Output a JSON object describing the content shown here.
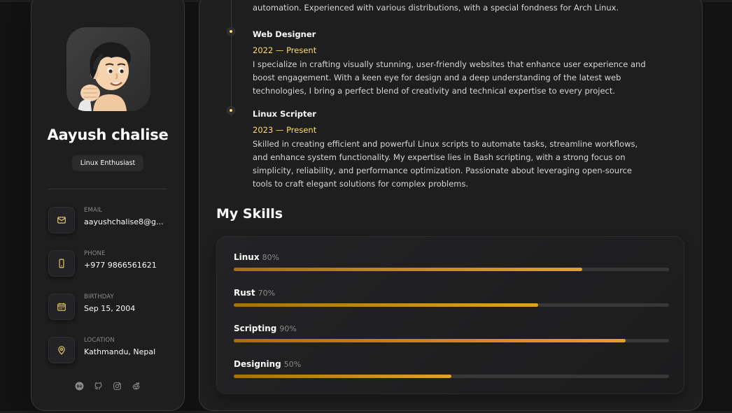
{
  "profile": {
    "name": "Aayush chalise",
    "title": "Linux Enthusiast"
  },
  "contacts": [
    {
      "label": "EMAIL",
      "value": "aayushchalise8@g...",
      "icon": "mail-icon"
    },
    {
      "label": "PHONE",
      "value": "+977 9866561621",
      "icon": "phone-icon"
    },
    {
      "label": "BIRTHDAY",
      "value": "Sep 15, 2004",
      "icon": "calendar-icon"
    },
    {
      "label": "LOCATION",
      "value": "Kathmandu, Nepal",
      "icon": "location-icon"
    }
  ],
  "social": [
    "behance-icon",
    "github-icon",
    "instagram-icon",
    "reddit-icon"
  ],
  "timeline": {
    "intro_tail": "automation. Experienced with various distributions, with a special fondness for Arch Linux.",
    "items": [
      {
        "title": "Web Designer",
        "date": "2022 — Present",
        "text": "I specialize in crafting visually stunning, user-friendly websites that enhance user experience and boost engagement. With a keen eye for design and a deep understanding of the latest web technologies, I bring a perfect blend of creativity and technical expertise to every project."
      },
      {
        "title": "Linux Scripter",
        "date": "2023 — Present",
        "text": "Skilled in creating efficient and powerful Linux scripts to automate tasks, streamline workflows, and enhance system functionality. My expertise lies in Bash scripting, with a strong focus on simplicity, reliability, and performance optimization. Passionate about leveraging open-source tools to craft elegant solutions for complex problems."
      }
    ]
  },
  "skills": {
    "heading": "My Skills",
    "items": [
      {
        "name": "Linux",
        "percent_label": "80%",
        "value": 80
      },
      {
        "name": "Rust",
        "percent_label": "70%",
        "value": 70
      },
      {
        "name": "Scripting",
        "percent_label": "90%",
        "value": 90
      },
      {
        "name": "Designing",
        "percent_label": "50%",
        "value": 50
      }
    ]
  },
  "colors": {
    "accent": "#ffdb70",
    "bar_fill": "#c98a1e",
    "panel": "#1e1e1f",
    "background": "#121212"
  }
}
